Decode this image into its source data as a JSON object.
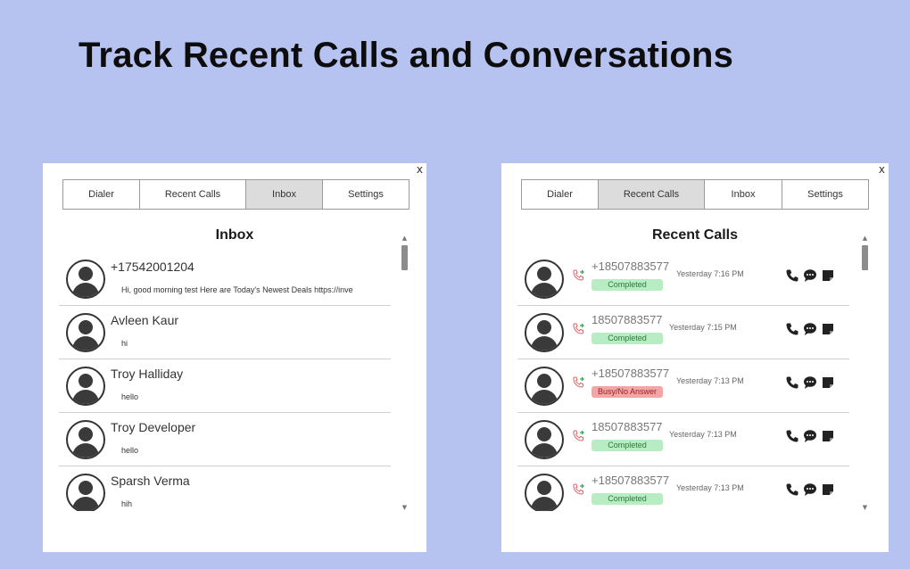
{
  "headline": "Track Recent Calls and Conversations",
  "colors": {
    "background": "#b6c3f1",
    "completed_bg": "#b8ecc2",
    "busy_bg": "#f6a5a6",
    "active_tab_bg": "#dcdcdc"
  },
  "inbox_panel": {
    "close_label": "x",
    "tabs": [
      {
        "label": "Dialer"
      },
      {
        "label": "Recent Calls"
      },
      {
        "label": "Inbox"
      },
      {
        "label": "Settings"
      }
    ],
    "active_tab": "Inbox",
    "title": "Inbox",
    "messages": [
      {
        "name": "+17542001204",
        "snippet": "Hi, good morning test Here are Today's Newest Deals https://inve"
      },
      {
        "name": "Avleen Kaur",
        "snippet": "hi"
      },
      {
        "name": "Troy Halliday",
        "snippet": "hello"
      },
      {
        "name": "Troy Developer",
        "snippet": "hello"
      },
      {
        "name": "Sparsh Verma",
        "snippet": "hih"
      }
    ]
  },
  "calls_panel": {
    "close_label": "x",
    "tabs": [
      {
        "label": "Dialer"
      },
      {
        "label": "Recent Calls"
      },
      {
        "label": "Inbox"
      },
      {
        "label": "Settings"
      }
    ],
    "active_tab": "Recent Calls",
    "title": "Recent Calls",
    "calls": [
      {
        "number": "+18507883577",
        "time": "Yesterday 7:16 PM",
        "status": "Completed",
        "status_type": "completed"
      },
      {
        "number": "18507883577",
        "time": "Yesterday 7:15 PM",
        "status": "Completed",
        "status_type": "completed"
      },
      {
        "number": "+18507883577",
        "time": "Yesterday 7:13 PM",
        "status": "Busy/No Answer",
        "status_type": "busy"
      },
      {
        "number": "18507883577",
        "time": "Yesterday 7:13 PM",
        "status": "Completed",
        "status_type": "completed"
      },
      {
        "number": "+18507883577",
        "time": "Yesterday 7:13 PM",
        "status": "Completed",
        "status_type": "completed"
      }
    ],
    "row_icons": [
      "outgoing-call-icon",
      "phone-icon",
      "chat-bubble-icon",
      "note-icon"
    ]
  }
}
